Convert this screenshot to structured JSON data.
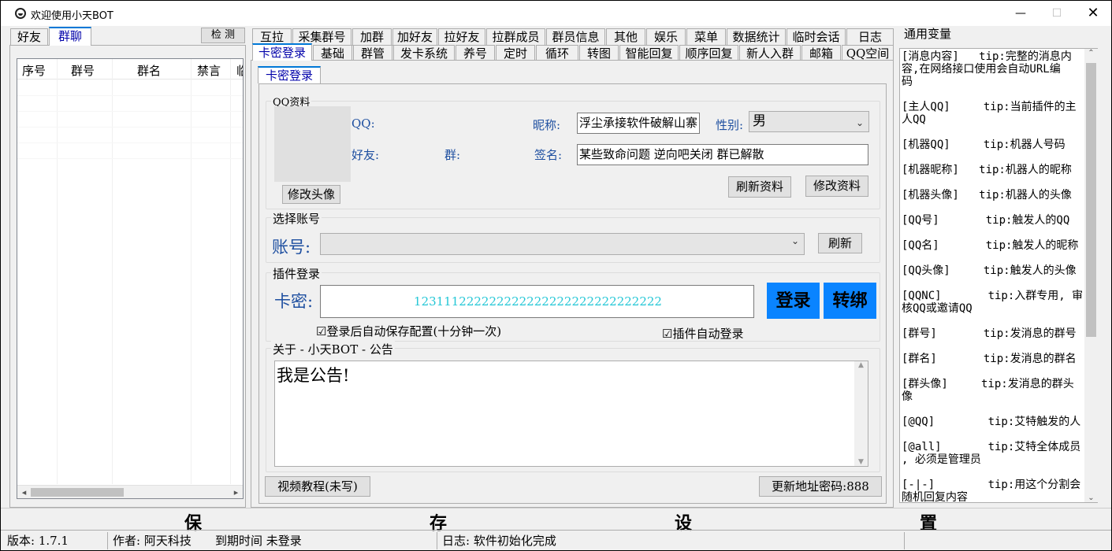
{
  "window": {
    "title": "欢迎使用小天BOT",
    "minimize_glyph": "—",
    "maximize_glyph": "☐",
    "close_glyph": "✕"
  },
  "left_tabs": [
    "好友",
    "群聊"
  ],
  "left_tab_active": 1,
  "detect_button": "检 测",
  "group_table": {
    "columns": [
      "序号",
      "群号",
      "群名",
      "禁言",
      "临"
    ]
  },
  "top_tabs_row1": [
    "互拉",
    "采集群号",
    "加群",
    "加好友",
    "拉好友",
    "拉群成员",
    "群员信息",
    "其他",
    "娱乐",
    "菜单",
    "数据统计",
    "临时会话",
    "日志"
  ],
  "top_tabs_row2": [
    "卡密登录",
    "基础",
    "群管",
    "发卡系统",
    "养号",
    "定时",
    "循环",
    "转图",
    "智能回复",
    "顺序回复",
    "新人入群",
    "邮箱",
    "QQ空间"
  ],
  "top_tab_active": 0,
  "inner_tab": "卡密登录",
  "qq_profile": {
    "group_label": "QQ资料",
    "qq_label": "QQ:",
    "friends_label": "好友:",
    "groups_label": "群:",
    "nickname_label": "昵称:",
    "nickname_value": "浮尘承接软件破解山寨",
    "gender_label": "性别:",
    "gender_value": "男",
    "signature_label": "签名:",
    "signature_value": "某些致命问题 逆向吧关闭 群已解散",
    "change_avatar_button": "修改头像",
    "refresh_profile_button": "刷新资料",
    "edit_profile_button": "修改资料"
  },
  "account_select": {
    "group_label": "选择账号",
    "account_label": "账号:",
    "account_value": "",
    "refresh_button": "刷新"
  },
  "plugin_login": {
    "group_label": "插件登录",
    "card_label": "卡密:",
    "card_value": "123111222222222222222222222222222",
    "login_button": "登录",
    "bind_button": "转绑",
    "autosave_label": "登录后自动保存配置(十分钟一次)",
    "autosave_checked": true,
    "autologin_label": "插件自动登录",
    "autologin_checked": true
  },
  "announcement": {
    "group_label": "关于 - 小天BOT - 公告",
    "text": "我是公告!"
  },
  "video_tutorial_button": "视频教程(未写)",
  "update_button": "更新地址密码:888",
  "vars_title": "通用变量",
  "variables": [
    {
      "line1": "[消息内容]   tip:完整的消息内",
      "line2": "容,在网络接口使用会自动URL编",
      "line3": "码"
    },
    {
      "line1": "[主人QQ]     tip:当前插件的主",
      "line2": "人QQ"
    },
    {
      "line1": "[机器QQ]     tip:机器人号码"
    },
    {
      "line1": "[机器昵称]   tip:机器人的昵称"
    },
    {
      "line1": "[机器头像]   tip:机器人的头像"
    },
    {
      "line1": "[QQ号]       tip:触发人的QQ"
    },
    {
      "line1": "[QQ名]       tip:触发人的昵称"
    },
    {
      "line1": "[QQ头像]     tip:触发人的头像"
    },
    {
      "line1": "[QQNC]       tip:入群专用, 审",
      "line2": "核QQ或邀请QQ"
    },
    {
      "line1": "[群号]       tip:发消息的群号"
    },
    {
      "line1": "[群名]       tip:发消息的群名"
    },
    {
      "line1": "[群头像]     tip:发消息的群头",
      "line2": "像"
    },
    {
      "line1": "[@QQ]        tip:艾特触发的人"
    },
    {
      "line1": "[@all]       tip:艾特全体成员",
      "line2": ", 必须是管理员"
    },
    {
      "line1": "[-|-]        tip:用这个分割会",
      "line2": "随机回复内容"
    }
  ],
  "save_bar": [
    "保",
    "存",
    "设",
    "置"
  ],
  "status_bar": {
    "version": "版本: 1.7.1",
    "author": "作者: 阿天科技",
    "expire": "到期时间 未登录",
    "log": "日志: 软件初始化完成"
  },
  "colors": {
    "accent_blue": "#0078d7",
    "login_button_bg": "#0a84ff",
    "card_text": "#25c7d6",
    "label_blue": "#1e4fa0"
  }
}
